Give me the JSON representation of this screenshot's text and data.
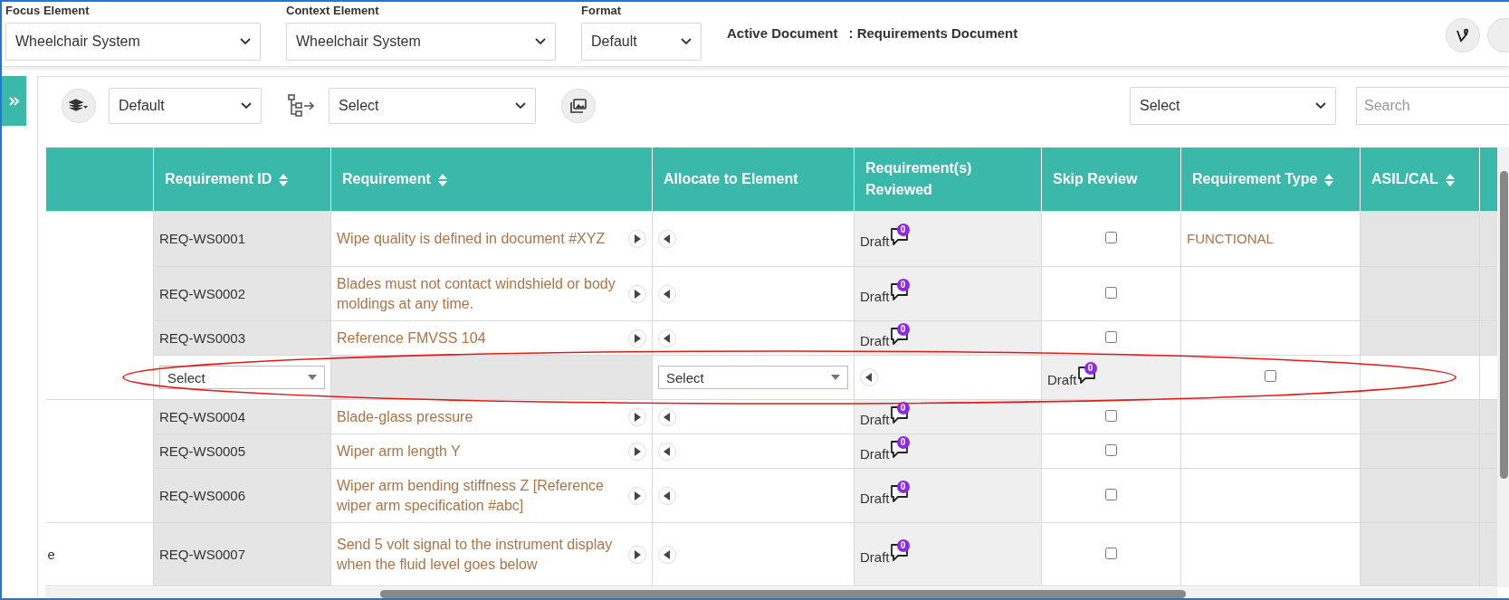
{
  "filters": [
    {
      "label": "Focus Element",
      "value": "Wheelchair System"
    },
    {
      "label": "Context Element",
      "value": "Wheelchair System"
    },
    {
      "label": "Format",
      "value": "Default"
    }
  ],
  "active_document": {
    "label": "Active Document",
    "value": ": Requirements Document"
  },
  "toolbar": {
    "view": "Default",
    "relation": "Select",
    "filter": "Select",
    "search_placeholder": "Search"
  },
  "table": {
    "columns": [
      {
        "label": "Requirement ID",
        "sortable": true
      },
      {
        "label": "Requirement",
        "sortable": true
      },
      {
        "label": "Allocate to Element",
        "sortable": false
      },
      {
        "label": "Requirement(s) Reviewed",
        "sortable": false
      },
      {
        "label": "Skip Review",
        "sortable": false
      },
      {
        "label": "Requirement Type",
        "sortable": true
      },
      {
        "label": "ASIL/CAL",
        "sortable": true
      }
    ],
    "groups": [
      {
        "rows": [
          {
            "kind": "requirement",
            "id": "REQ-WS0001",
            "text": "Wipe quality is defined in document #XYZ",
            "status": "Draft",
            "comments": "0",
            "skip_review": false,
            "type": "FUNCTIONAL"
          },
          {
            "kind": "requirement",
            "id": "REQ-WS0002",
            "text": "Blades must not contact windshield or body moldings at any time.",
            "status": "Draft",
            "comments": "0",
            "skip_review": false
          },
          {
            "kind": "requirement",
            "id": "REQ-WS0003",
            "text": "Reference FMVSS 104",
            "status": "Draft",
            "comments": "0",
            "skip_review": false
          },
          {
            "kind": "new",
            "id_select": "Select",
            "allocate_select": "Select",
            "status": "Draft",
            "comments": "0",
            "skip_review": false
          }
        ]
      },
      {
        "rows": [
          {
            "kind": "requirement",
            "id": "REQ-WS0004",
            "text": "Blade-glass pressure",
            "status": "Draft",
            "comments": "0",
            "skip_review": false
          },
          {
            "kind": "requirement",
            "id": "REQ-WS0005",
            "text": "Wiper arm length Y",
            "status": "Draft",
            "comments": "0",
            "skip_review": false
          },
          {
            "kind": "requirement",
            "id": "REQ-WS0006",
            "text": "Wiper arm bending stiffness Z [Reference wiper arm specification #abc]",
            "status": "Draft",
            "comments": "0",
            "skip_review": false
          }
        ]
      },
      {
        "label": "e",
        "rows": [
          {
            "kind": "requirement",
            "id": "REQ-WS0007",
            "text": "Send 5 volt signal to the instrument display when the fluid level goes below",
            "status": "Draft",
            "comments": "0",
            "skip_review": false
          }
        ]
      }
    ]
  }
}
